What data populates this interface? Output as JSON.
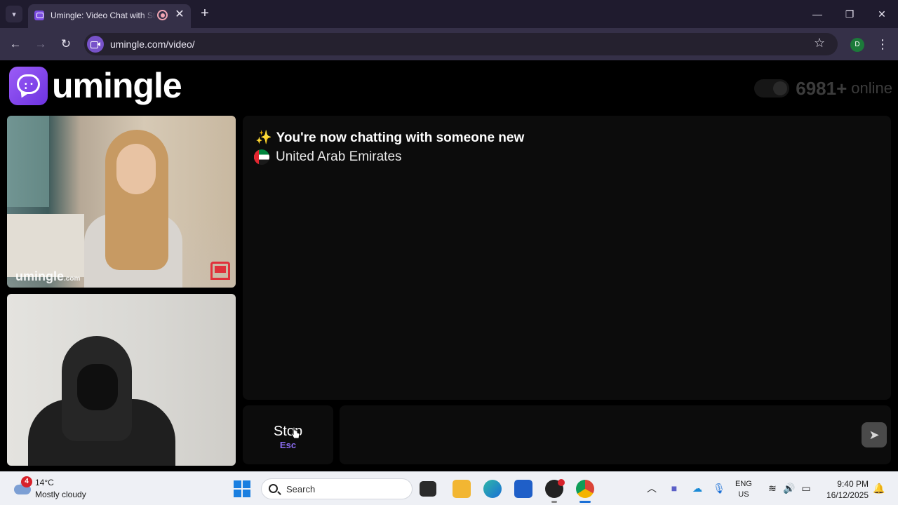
{
  "browser": {
    "tab_title": "Umingle: Video Chat with Strangers",
    "url": "umingle.com/video/",
    "profile_initial": "D",
    "icons": [
      "tab-list-icon",
      "record-icon",
      "close-icon",
      "plus-icon",
      "minimize-icon",
      "restore-icon",
      "back-icon",
      "forward-icon",
      "reload-icon",
      "star-icon",
      "menu-icon"
    ]
  },
  "site": {
    "logo_text": "umingle",
    "online_count": "6981+",
    "online_label": "online",
    "watermark": "umingle",
    "watermark_suffix": ".com"
  },
  "chat": {
    "sparkle": "✨",
    "status": "You're now chatting with someone new",
    "country": "United Arab Emirates"
  },
  "controls": {
    "stop_label": "Stop",
    "stop_key": "Esc",
    "send_icon": "send-icon"
  },
  "taskbar": {
    "weather_badge": "4",
    "temperature": "14°C",
    "weather": "Mostly cloudy",
    "search_label": "Search",
    "lang_top": "ENG",
    "lang_bottom": "US",
    "time": "9:40 PM",
    "date": "16/12/2025"
  },
  "colors": {
    "accent": "#8b5cf6",
    "report": "#e0313b"
  }
}
